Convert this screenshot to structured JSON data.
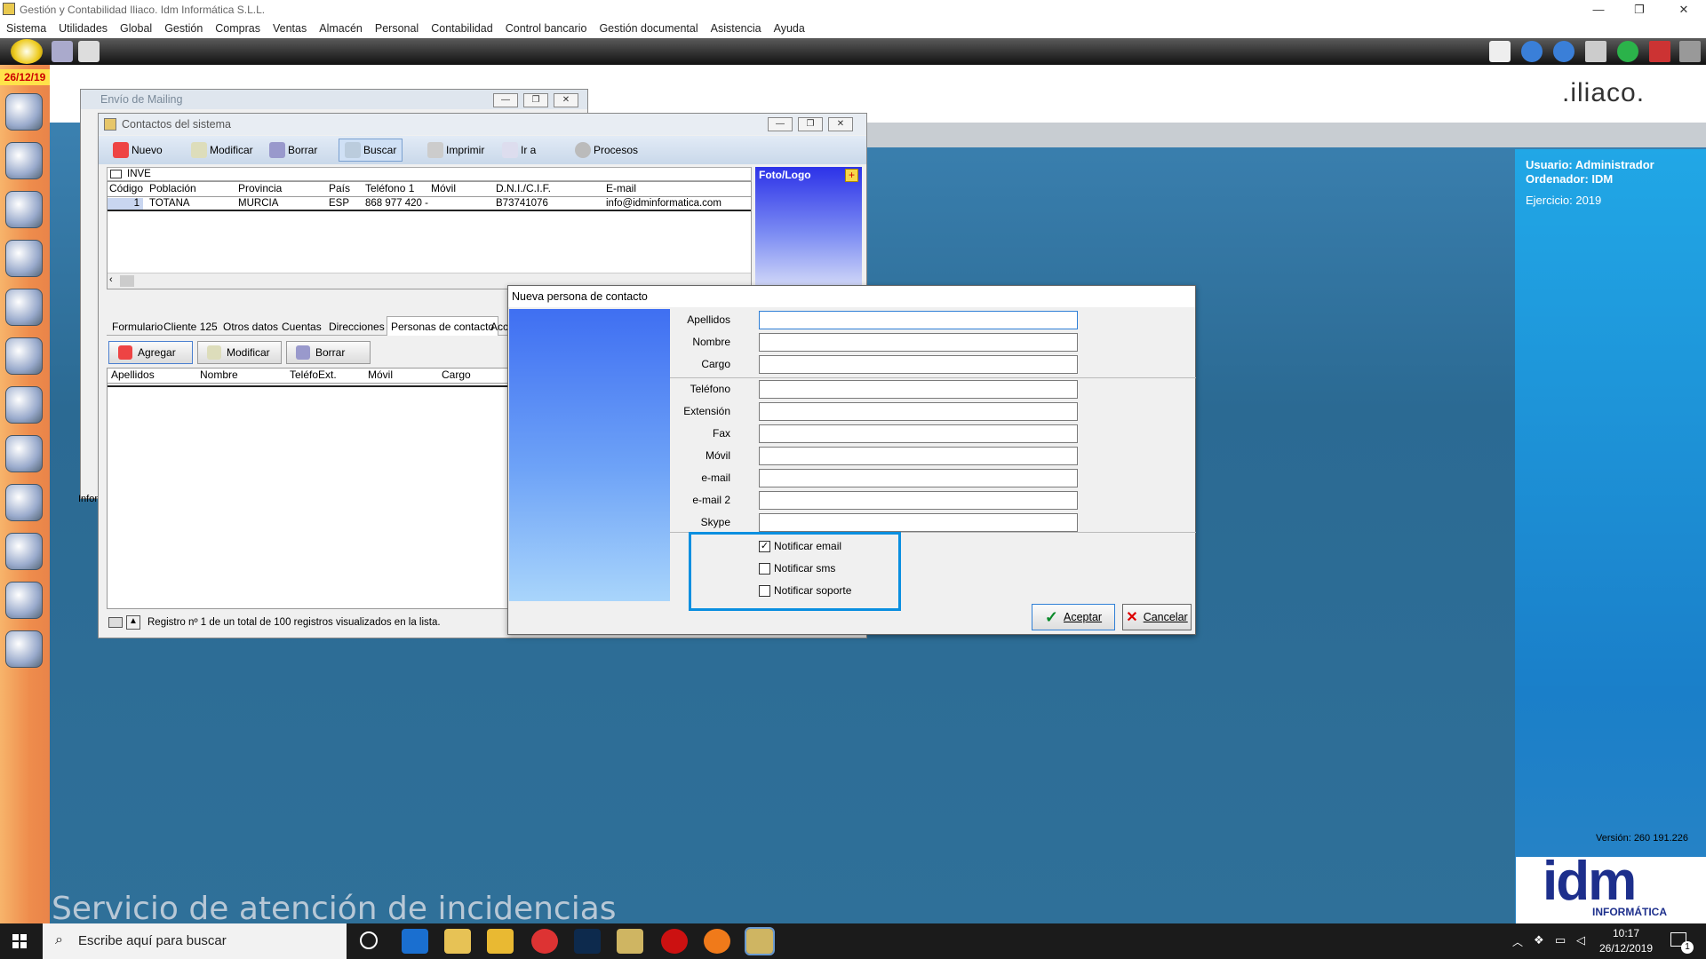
{
  "app": {
    "title": "Gestión y Contabilidad Iliaco. Idm Informática S.L.L.",
    "window_controls": [
      "—",
      "❐",
      "✕"
    ]
  },
  "menu": [
    "Sistema",
    "Utilidades",
    "Global",
    "Gestión",
    "Compras",
    "Ventas",
    "Almacén",
    "Personal",
    "Contabilidad",
    "Control bancario",
    "Gestión documental",
    "Asistencia",
    "Ayuda"
  ],
  "date_badge": "26/12/19",
  "brand": {
    "logo_text": ".iliaco.",
    "bottom_text": "Servicio de atención de incidencias"
  },
  "right_panel": {
    "usuario": "Usuario: Administrador",
    "ordenador": "Ordenador:  IDM",
    "ejercicio": "Ejercicio: 2019",
    "version": "Versión: 260 191.226",
    "logo": "idm",
    "logo_sub": "INFORMÁTICA"
  },
  "mailing_window": {
    "title": "Envío de Mailing",
    "footer_fragment": "Infor"
  },
  "contacts_window": {
    "title": "Contactos del sistema",
    "toolbar": [
      "Nuevo",
      "Modificar",
      "Borrar",
      "Buscar",
      "Imprimir",
      "Ir a",
      "Procesos"
    ],
    "search_value": "INVE",
    "columns": [
      "Código",
      "Población",
      "Provincia",
      "País",
      "Teléfono 1",
      "Móvil",
      "D.N.I./C.I.F.",
      "E-mail"
    ],
    "rows": [
      [
        "1",
        "TOTANA",
        "MURCIA",
        "ESP",
        "868 977 420 -",
        "",
        "B73741076",
        "info@idminformatica.com"
      ]
    ],
    "photo_label": "Foto/Logo",
    "tabs": [
      "Formulario",
      "Cliente 125",
      "Otros datos",
      "Cuentas",
      "Direcciones",
      "Personas de contacto",
      "Acci"
    ],
    "sub_buttons": [
      "Agregar",
      "Modificar",
      "Borrar"
    ],
    "sub_columns": [
      "Apellidos",
      "Nombre",
      "Teléfo",
      "Ext.",
      "Móvil",
      "Cargo"
    ],
    "status": "Registro nº 1 de un total de 100 registros visualizados en la lista."
  },
  "dialog": {
    "title": "Nueva persona de contacto",
    "fields_a": [
      {
        "label": "Apellidos",
        "value": ""
      },
      {
        "label": "Nombre",
        "value": ""
      },
      {
        "label": "Cargo",
        "value": ""
      }
    ],
    "fields_b": [
      {
        "label": "Teléfono",
        "value": ""
      },
      {
        "label": "Extensión",
        "value": ""
      },
      {
        "label": "Fax",
        "value": ""
      },
      {
        "label": "Móvil",
        "value": ""
      },
      {
        "label": "e-mail",
        "value": ""
      },
      {
        "label": "e-mail 2",
        "value": ""
      },
      {
        "label": "Skype",
        "value": ""
      }
    ],
    "checks": [
      {
        "label": "Notificar email",
        "checked": true
      },
      {
        "label": "Notificar sms",
        "checked": false
      },
      {
        "label": "Notificar soporte",
        "checked": false
      }
    ],
    "accept": "Aceptar",
    "cancel": "Cancelar"
  },
  "taskbar": {
    "search_placeholder": "Escribe aquí para buscar",
    "time": "10:17",
    "date": "26/12/2019",
    "notification_count": "1"
  }
}
